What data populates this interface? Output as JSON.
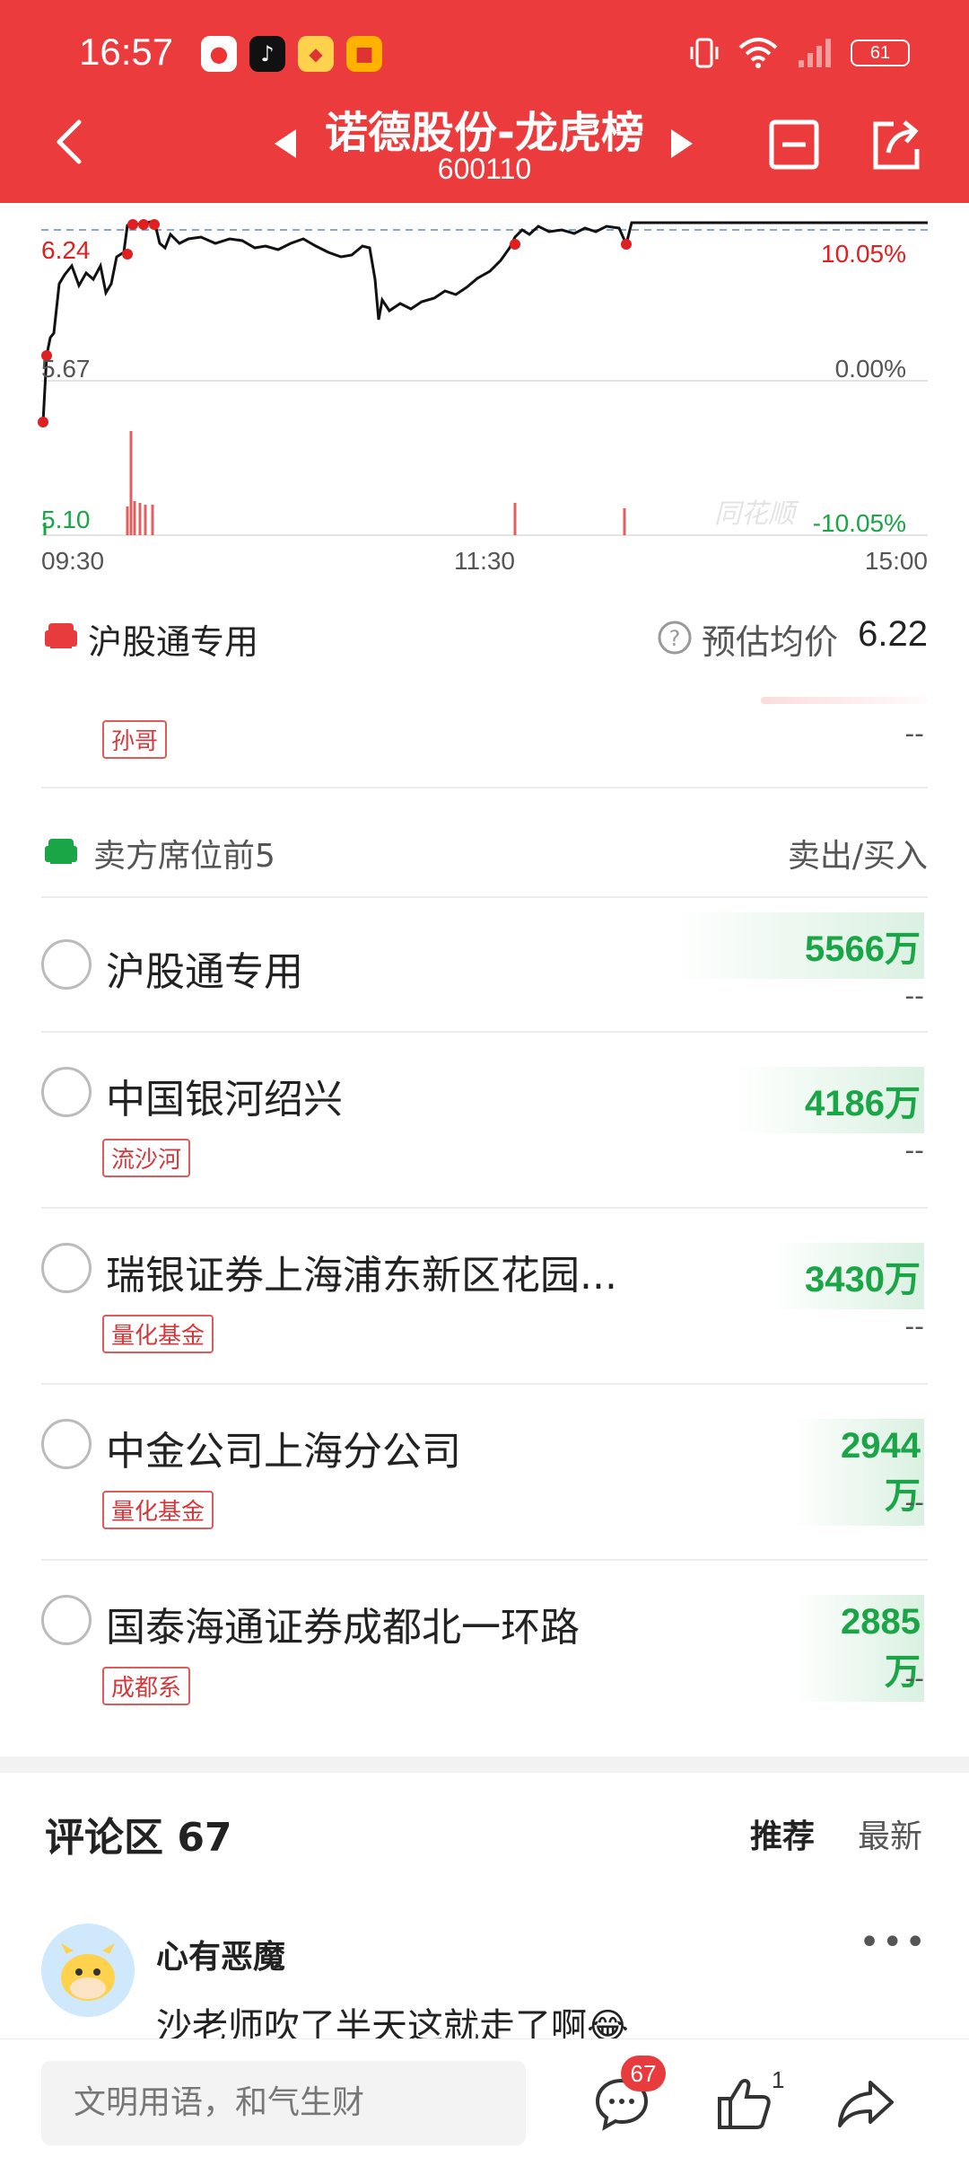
{
  "status_bar": {
    "time": "16:57",
    "battery": "61",
    "app_icons": [
      "weibo-icon",
      "tiktok-icon",
      "app-icon",
      "wallet-icon"
    ],
    "right_icons": [
      "vibrate-icon",
      "wifi-icon",
      "signal-icon",
      "battery-icon"
    ]
  },
  "nav": {
    "title": "诺德股份-龙虎榜",
    "code": "600110"
  },
  "chart": {
    "top_price": "6.24",
    "mid_price": "5.67",
    "low_price": "5.10",
    "top_pct": "10.05%",
    "mid_pct": "0.00%",
    "low_pct": "-10.05%",
    "time_start": "09:30",
    "time_mid": "11:30",
    "time_end": "15:00",
    "watermark": "同花顺",
    "colors": {
      "up": "#e02020",
      "down": "#1aa546",
      "line": "#111111"
    }
  },
  "avg": {
    "label": "沪股通专用",
    "est_label": "预估均价",
    "est_value": "6.22"
  },
  "partial_row": {
    "tag": "孙哥",
    "dash": "--"
  },
  "sell_section": {
    "title": "卖方席位前5",
    "right_label": "卖出/买入",
    "rows": [
      {
        "name": "沪股通专用",
        "tag": "",
        "amount": "5566万",
        "dash": "--"
      },
      {
        "name": "中国银河绍兴",
        "tag": "流沙河",
        "amount": "4186万",
        "dash": "--"
      },
      {
        "name": "瑞银证券上海浦东新区花园...",
        "tag": "量化基金",
        "amount": "3430万",
        "dash": "--"
      },
      {
        "name": "中金公司上海分公司",
        "tag": "量化基金",
        "amount": "2944万",
        "dash": "--"
      },
      {
        "name": "国泰海通证券成都北一环路",
        "tag": "成都系",
        "amount": "2885万",
        "dash": "--"
      }
    ]
  },
  "comments": {
    "title": "评论区 67",
    "tab_recommend": "推荐",
    "tab_latest": "最新",
    "first": {
      "user": "心有恶魔",
      "text": "沙老师吹了半天这就走了啊😂"
    }
  },
  "bottom": {
    "input_placeholder": "文明用语，和气生财",
    "comment_count": "67",
    "like_count": "1"
  }
}
